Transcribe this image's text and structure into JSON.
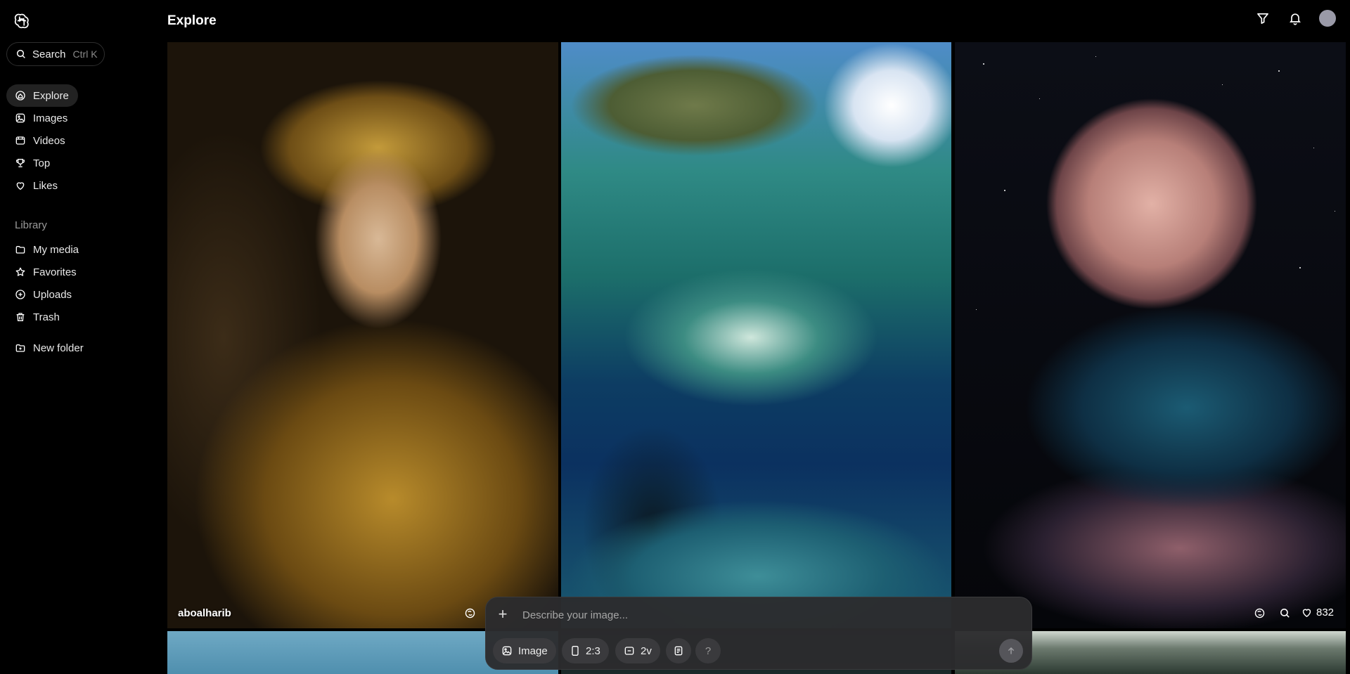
{
  "header": {
    "title": "Explore"
  },
  "search": {
    "label": "Search",
    "shortcut": "Ctrl K"
  },
  "nav": {
    "explore": "Explore",
    "images": "Images",
    "videos": "Videos",
    "top": "Top",
    "likes": "Likes"
  },
  "library": {
    "heading": "Library",
    "my_media": "My media",
    "favorites": "Favorites",
    "uploads": "Uploads",
    "trash": "Trash",
    "new_folder": "New folder"
  },
  "feed": {
    "tiles": [
      {
        "user": "aboalharib"
      },
      {
        "user": ""
      },
      {
        "likes": "832"
      }
    ]
  },
  "composer": {
    "placeholder": "Describe your image...",
    "mode": "Image",
    "aspect": "2:3",
    "variations": "2v",
    "help": "?"
  },
  "colors": {
    "background": "#000000",
    "active_nav": "#222222",
    "composer_bg": "#2c2c2e"
  }
}
